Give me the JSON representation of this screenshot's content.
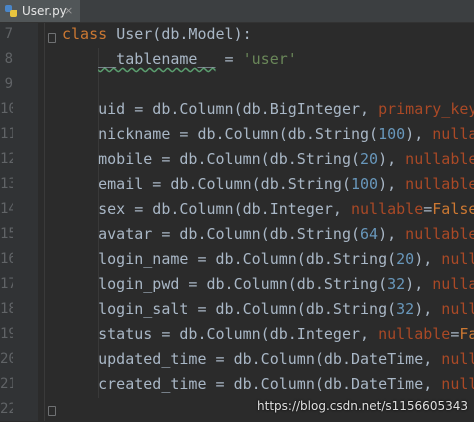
{
  "tab": {
    "label": "User.py",
    "close": "×"
  },
  "lines": [
    {
      "num": "7",
      "tokens": [
        {
          "t": "class ",
          "c": "kw"
        },
        {
          "t": "User(db.Model):",
          "c": ""
        }
      ]
    },
    {
      "num": "8",
      "tokens": [
        {
          "t": "    ",
          "c": ""
        },
        {
          "t": "__tablename__",
          "c": "dunder"
        },
        {
          "t": " = ",
          "c": ""
        },
        {
          "t": "'user'",
          "c": "st"
        }
      ]
    },
    {
      "num": "9",
      "tokens": []
    },
    {
      "num": "10",
      "tokens": [
        {
          "t": "    uid = db.Column(db.BigInteger, ",
          "c": ""
        },
        {
          "t": "primary_key",
          "c": "pr"
        },
        {
          "t": "=T",
          "c": ""
        }
      ]
    },
    {
      "num": "11",
      "tokens": [
        {
          "t": "    nickname = db.Column(db.String(",
          "c": ""
        },
        {
          "t": "100",
          "c": "nu"
        },
        {
          "t": "), ",
          "c": ""
        },
        {
          "t": "nullab",
          "c": "pr"
        }
      ]
    },
    {
      "num": "12",
      "tokens": [
        {
          "t": "    mobile = db.Column(db.String(",
          "c": ""
        },
        {
          "t": "20",
          "c": "nu"
        },
        {
          "t": "), ",
          "c": ""
        },
        {
          "t": "nullable",
          "c": "pr"
        },
        {
          "t": "=F",
          "c": ""
        }
      ]
    },
    {
      "num": "13",
      "tokens": [
        {
          "t": "    email = db.Column(db.String(",
          "c": ""
        },
        {
          "t": "100",
          "c": "nu"
        },
        {
          "t": "), ",
          "c": ""
        },
        {
          "t": "nullable",
          "c": "pr"
        },
        {
          "t": "=F",
          "c": ""
        }
      ]
    },
    {
      "num": "14",
      "tokens": [
        {
          "t": "    sex = db.Column(db.Integer, ",
          "c": ""
        },
        {
          "t": "nullable",
          "c": "pr"
        },
        {
          "t": "=",
          "c": ""
        },
        {
          "t": "False",
          "c": "kw"
        },
        {
          "t": ",",
          "c": ""
        }
      ]
    },
    {
      "num": "15",
      "tokens": [
        {
          "t": "    avatar = db.Column(db.String(",
          "c": ""
        },
        {
          "t": "64",
          "c": "nu"
        },
        {
          "t": "), ",
          "c": ""
        },
        {
          "t": "nullable",
          "c": "pr"
        },
        {
          "t": "=F",
          "c": ""
        }
      ]
    },
    {
      "num": "16",
      "tokens": [
        {
          "t": "    login_name = db.Column(db.String(",
          "c": ""
        },
        {
          "t": "20",
          "c": "nu"
        },
        {
          "t": "), ",
          "c": ""
        },
        {
          "t": "nullab",
          "c": "pr"
        }
      ]
    },
    {
      "num": "17",
      "tokens": [
        {
          "t": "    login_pwd = db.Column(db.String(",
          "c": ""
        },
        {
          "t": "32",
          "c": "nu"
        },
        {
          "t": "), ",
          "c": ""
        },
        {
          "t": "nullabl",
          "c": "pr"
        }
      ]
    },
    {
      "num": "18",
      "tokens": [
        {
          "t": "    login_salt = db.Column(db.String(",
          "c": ""
        },
        {
          "t": "32",
          "c": "nu"
        },
        {
          "t": "), ",
          "c": ""
        },
        {
          "t": "nullab",
          "c": "pr"
        }
      ]
    },
    {
      "num": "19",
      "tokens": [
        {
          "t": "    status = db.Column(db.Integer, ",
          "c": ""
        },
        {
          "t": "nullable",
          "c": "pr"
        },
        {
          "t": "=",
          "c": ""
        },
        {
          "t": "Fals",
          "c": "kw"
        }
      ]
    },
    {
      "num": "20",
      "tokens": [
        {
          "t": "    updated_time = db.Column(db.DateTime, ",
          "c": ""
        },
        {
          "t": "nullab",
          "c": "pr"
        }
      ]
    },
    {
      "num": "21",
      "tokens": [
        {
          "t": "    created_time = db.Column(db.DateTime, ",
          "c": ""
        },
        {
          "t": "nullab",
          "c": "pr"
        }
      ]
    },
    {
      "num": "22",
      "tokens": []
    }
  ],
  "watermark": "https://blog.csdn.net/s1156605343",
  "colors": {
    "background": "#2b2b2b",
    "keyword": "#cc7832",
    "param": "#aa4926",
    "string": "#6a8759",
    "number": "#6897bb",
    "default_text": "#a9b7c6"
  }
}
